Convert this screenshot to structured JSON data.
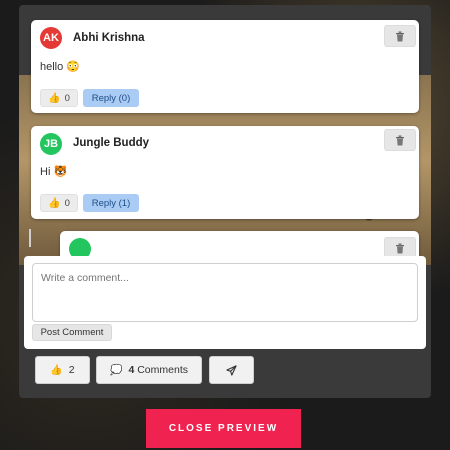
{
  "comments": [
    {
      "initials": "AK",
      "author": "Abhi Krishna",
      "text": "hello 😳",
      "likes": "0",
      "reply_label": "Reply (0)",
      "avatar_color": "#e53935"
    },
    {
      "initials": "JB",
      "author": "Jungle Buddy",
      "text": "Hi 🐯",
      "likes": "0",
      "reply_label": "Reply (1)",
      "avatar_color": "#22c55e"
    }
  ],
  "composer": {
    "placeholder": "Write a comment...",
    "post_label": "Post Comment"
  },
  "actions": {
    "likes": "2",
    "comments_count": "4",
    "comments_word": "Comments"
  },
  "close_label": "CLOSE PREVIEW",
  "colors": {
    "accent": "#f0224f",
    "reply_bg": "#a9cbf4",
    "reply_text": "#1d4f86"
  },
  "icons": {
    "like": "thumbs-up-icon",
    "comment": "speech-bubble-icon",
    "share": "send-icon",
    "delete": "trash-icon"
  }
}
